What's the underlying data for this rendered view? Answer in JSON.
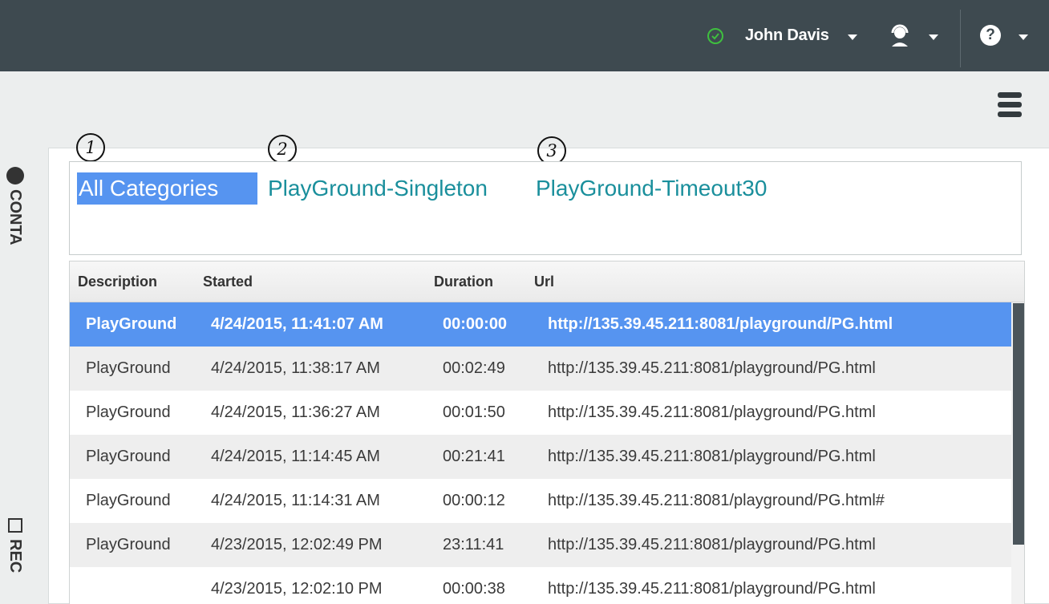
{
  "header": {
    "user_name": "John Davis",
    "status_color": "#3fbf3f",
    "status_icon": "check-circle-icon",
    "agent_icon": "agent-headset-icon",
    "help_glyph": "?",
    "menu_icon": "hamburger-icon"
  },
  "sidebar": {
    "label_top": "CONTA",
    "label_bottom": "REC"
  },
  "categories": {
    "markers": [
      "1",
      "2",
      "3"
    ],
    "items": [
      "All Categories",
      "PlayGround-Singleton",
      "PlayGround-Timeout30"
    ],
    "selected": "All Categories"
  },
  "table": {
    "columns": [
      "Description",
      "Started",
      "Duration",
      "Url"
    ],
    "rows": [
      [
        "PlayGround",
        "4/24/2015, 11:41:07 AM",
        "00:00:00",
        "http://135.39.45.211:8081/playground/PG.html"
      ],
      [
        "PlayGround",
        "4/24/2015, 11:38:17 AM",
        "00:02:49",
        "http://135.39.45.211:8081/playground/PG.html"
      ],
      [
        "PlayGround",
        "4/24/2015, 11:36:27 AM",
        "00:01:50",
        "http://135.39.45.211:8081/playground/PG.html"
      ],
      [
        "PlayGround",
        "4/24/2015, 11:14:45 AM",
        "00:21:41",
        "http://135.39.45.211:8081/playground/PG.html"
      ],
      [
        "PlayGround",
        "4/24/2015, 11:14:31 AM",
        "00:00:12",
        "http://135.39.45.211:8081/playground/PG.html#"
      ],
      [
        "PlayGround",
        "4/23/2015, 12:02:49 PM",
        "23:11:41",
        "http://135.39.45.211:8081/playground/PG.html"
      ],
      [
        "",
        "4/23/2015, 12:02:10 PM",
        "00:00:38",
        "http://135.39.45.211:8081/playground/PG.html"
      ]
    ],
    "selected_row": 0
  },
  "colors": {
    "topbar": "#3e4a50",
    "accent": "#5694f0",
    "link": "#1a8f9c"
  }
}
